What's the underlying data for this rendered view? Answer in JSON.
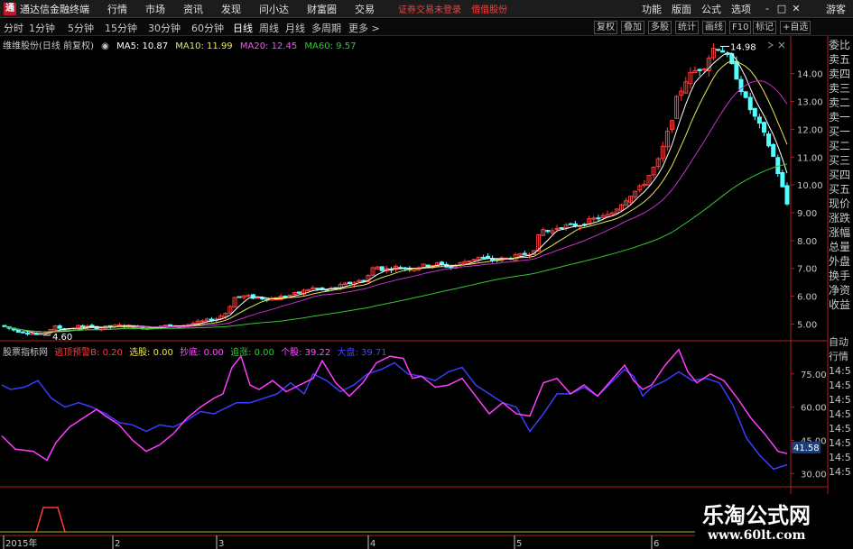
{
  "app": {
    "title": "通达信金融终端",
    "menu": [
      "行情",
      "市场",
      "资讯",
      "发现",
      "问小达",
      "财富圈",
      "交易"
    ],
    "status": [
      "证券交易未登录",
      "借借股份"
    ],
    "right_menu": [
      "功能",
      "版面",
      "公式",
      "选项"
    ],
    "window_controls": [
      "-",
      "□",
      "✕"
    ],
    "guest": "游客"
  },
  "periods": [
    "分时",
    "1分钟",
    "5分钟",
    "15分钟",
    "30分钟",
    "60分钟",
    "日线",
    "周线",
    "月线",
    "多周期",
    "更多 >"
  ],
  "active_period": "日线",
  "toolbar_buttons": [
    "复权",
    "叠加",
    "多股",
    "统计",
    "画线",
    "F10",
    "标记",
    "+自选"
  ],
  "stock_header": {
    "name": "维维股份(日线 前复权)",
    "ma5": "MA5: 10.87",
    "ma10": "MA10: 11.99",
    "ma20": "MA20: 12.45",
    "ma60": "MA60: 9.57"
  },
  "indicator_header": {
    "name": "股票指标网",
    "field1": "逃顶预警B: 0.20",
    "field2": "选股: 0.00",
    "field3": "抄底: 0.00",
    "field4": "追涨: 0.00",
    "field5": "个股: 39.22",
    "field6": "大盘: 39.71"
  },
  "right_tabs": [
    "委比",
    "卖五",
    "卖四",
    "卖三",
    "卖二",
    "卖一",
    "买一",
    "买二",
    "买三",
    "买四",
    "买五",
    "现价",
    "涨跌",
    "涨幅",
    "总量",
    "外盘",
    "换手",
    "净资",
    "收益"
  ],
  "right_tabs_lower": [
    "自动",
    "行情",
    "14:5",
    "14:5",
    "14:5",
    "14:5",
    "14:5",
    "14:5",
    "14:5",
    "14:5"
  ],
  "price_axis": [
    "14.00",
    "13.00",
    "12.00",
    "11.00",
    "10.00",
    "9.00",
    "8.00",
    "7.00",
    "6.00",
    "5.00"
  ],
  "price_extremes": {
    "high": "14.98",
    "low": "4.60"
  },
  "indicator_axis": [
    "75.00",
    "60.00",
    "45.00",
    "30.00"
  ],
  "indicator_current": "41.58",
  "date_axis": [
    "2015年",
    "2",
    "3",
    "4",
    "5",
    "6"
  ],
  "colors": {
    "up_candle": "#ff3c3c",
    "down_candle": "#54ffff",
    "ma5": "#ffffff",
    "ma10": "#e6e65a",
    "ma20": "#c832c8",
    "ma60": "#32c832",
    "stock_line": "#ff3cff",
    "index_line": "#3c3cff",
    "axis": "#b41e1e"
  },
  "watermark": {
    "title": "乐淘公式网",
    "url": "www.60lt.com"
  }
}
